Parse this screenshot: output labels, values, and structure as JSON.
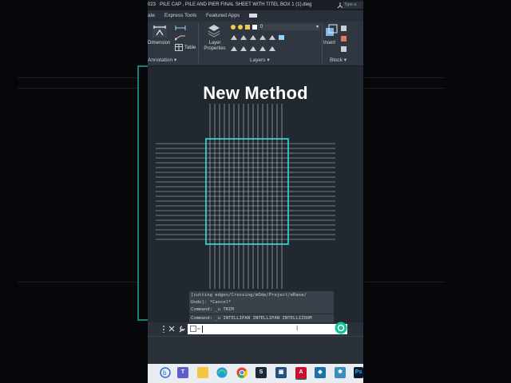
{
  "window": {
    "title_prefix": "023",
    "title": "PILE CAP , PILE AND PIER FINAL SHEET WITH TITEL BOX 1 (1).dwg",
    "search_placeholder": "Type a"
  },
  "tabs": [
    "ate",
    "Express Tools",
    "Featured Apps"
  ],
  "ribbon": {
    "dimension_label": "Dimension",
    "table_label": "Table",
    "layer_properties_label": "Layer\nProperties",
    "insert_label": "Insert",
    "layer_value": "0",
    "panels": {
      "annotation": "Annotation",
      "layers": "Layers",
      "block": "Block"
    }
  },
  "overlay": {
    "headline": "New Method"
  },
  "command_line": {
    "history": [
      "[cutting edges/Crossing/mOde/Project/eRase/",
      "Undo]: *Cancel*",
      "Command: _u TRIM",
      "Command: _u INTELLIPAN INTELLIPAN INTELLIZOOM"
    ],
    "input_value": ""
  },
  "taskbar": {
    "apps": [
      "tb-icon-1",
      "teams-icon",
      "files-icon",
      "edge-icon",
      "chrome-icon",
      "steam-icon",
      "store-icon",
      "autocad-icon",
      "app-icon",
      "app-icon-2",
      "photoshop-icon"
    ]
  },
  "colors": {
    "selection": "#2ee6d6",
    "canvas": "#212830",
    "grid_lines": "#c8ccd2"
  }
}
